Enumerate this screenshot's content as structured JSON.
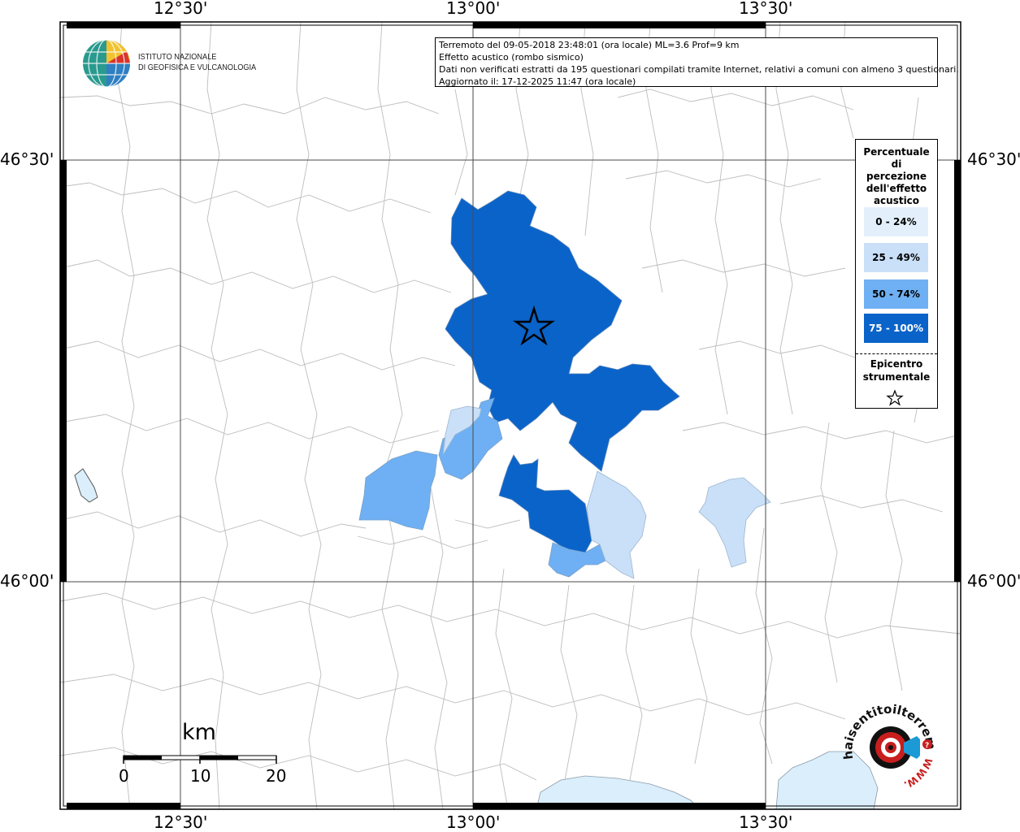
{
  "info": {
    "line1": "Terremoto del 09-05-2018 23:48:01 (ora locale) ML=3.6 Prof=9 km",
    "line2": "Effetto acustico (rombo sismico)",
    "line3": "Dati non verificati estratti da 195 questionari compilati tramite Internet, relativi a comuni con almeno 3 questionari.",
    "line4": "Aggiornato il: 17-12-2025 11:47 (ora locale)"
  },
  "institute": {
    "line1": "ISTITUTO NAZIONALE",
    "line2": "DI GEOFISICA E VULCANOLOGIA"
  },
  "axes": {
    "lon_labels": [
      "12°30'",
      "13°00'",
      "13°30'"
    ],
    "lat_labels": [
      "46°30'",
      "46°00'"
    ]
  },
  "legend": {
    "title": "Percentuale di percezione dell'effetto acustico",
    "items": [
      {
        "label": "0 - 24%",
        "color": "#e3f0fc"
      },
      {
        "label": "25 - 49%",
        "color": "#c9e0f8"
      },
      {
        "label": "50 - 74%",
        "color": "#6fb0f4"
      },
      {
        "label": "75 - 100%",
        "color": "#0a63c9"
      }
    ],
    "epicenter_label": "Epicentro strumentale"
  },
  "scale": {
    "unit": "km",
    "ticks": [
      "0",
      "10",
      "20"
    ]
  },
  "site_logo": {
    "text": "haisentitoilterremoto.it",
    "url_text": "WWW."
  },
  "colors": {
    "c75": "#0a63c9",
    "c50": "#6fb0f4",
    "c25": "#c9e0f8",
    "water": "#daeefb",
    "borders": "#b5b5b5"
  }
}
